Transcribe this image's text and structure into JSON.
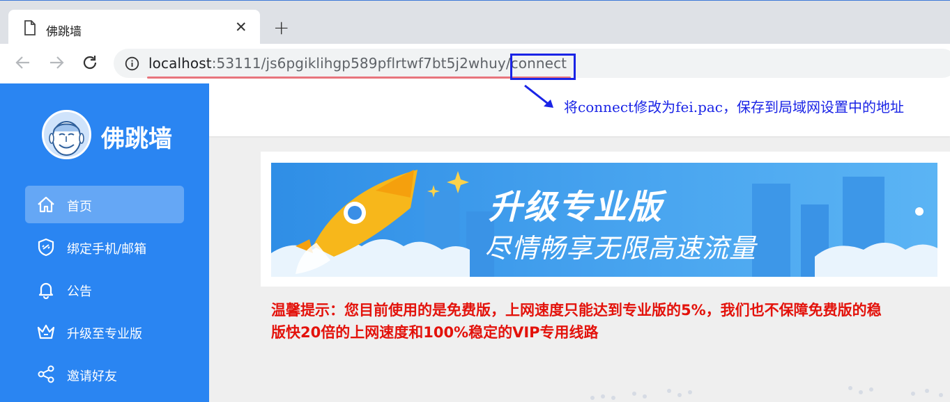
{
  "browser": {
    "tab_title": "佛跳墙",
    "tab_close": "✕",
    "new_tab": "+",
    "url_host": "localhost",
    "url_rest": ":53111/js6pgiklihgp589pflrtwf7bt5j2whuy/connect",
    "highlight_color": "#1a24e6",
    "underline_color": "#e8747c"
  },
  "annotation": {
    "note": "将connect修改为fei.pac，保存到局域网设置中的地址"
  },
  "sidebar": {
    "brand": "佛跳墙",
    "bg_color": "#2a85f2",
    "items": [
      {
        "label": "首页",
        "icon": "home-icon",
        "active": true
      },
      {
        "label": "绑定手机/邮箱",
        "icon": "shield-link-icon",
        "active": false
      },
      {
        "label": "公告",
        "icon": "bell-icon",
        "active": false
      },
      {
        "label": "升级至专业版",
        "icon": "crown-icon",
        "active": false
      },
      {
        "label": "邀请好友",
        "icon": "share-icon",
        "active": false
      }
    ]
  },
  "banner": {
    "title": "升级专业版",
    "subtitle": "尽情畅享无限高速流量"
  },
  "warning": {
    "line1": "温馨提示：您目前使用的是免费版，上网速度只能达到专业版的5%，我们也不保障免费版的稳",
    "line2": "版快20倍的上网速度和100%稳定的VIP专用线路",
    "color": "#e3120b"
  }
}
